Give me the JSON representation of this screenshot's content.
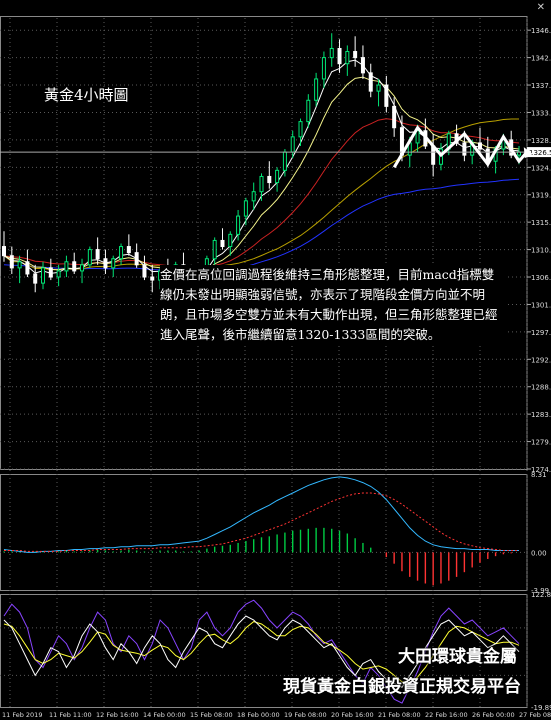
{
  "title_label": "黃金4小時圖",
  "commentary": "金價在高位回調過程後維持三角形態整理，目前macd指標雙線仍未發出明顯強弱信號，亦表示了現階段金價方向並不明朗，且市場多空雙方並未有大動作出現，但三角形態整理已經進入尾聲，後市繼續留意1320-1333區間的突破。",
  "watermark": {
    "line1": "大田環球貴金屬",
    "line2": "現貨黃金白銀投資正規交易平台"
  },
  "close_icon": "close-icon",
  "colors": {
    "background": "#000000",
    "grid": "#5a5a5a",
    "candle_up": "#00e676",
    "candle_down": "#ffffff",
    "ma_fast": "#ffffff",
    "ma_mid": "#f4f48c",
    "ma_slow": "#cc2222",
    "ma_blue": "#2233ff",
    "ma_gold": "#b8a000",
    "macd_signal": "#33b8ff",
    "macd_hist_pos": "#00cc44",
    "macd_hist_neg": "#ff3333",
    "macd_dotted": "#ff3333",
    "stoch_k": "#ffffff",
    "stoch_d": "#ffff33",
    "stoch_violet": "#8844ff",
    "triangle_arrow": "#ffffff",
    "price_marker_bg": "#ffffff"
  },
  "chart_data": [
    {
      "type": "candlestick",
      "title": "黃金4小時圖",
      "ylim": [
        1274.5,
        1348.5
      ],
      "yticks": [
        "1346.5",
        "1342.0",
        "1337.5",
        "1333.0",
        "1328.5",
        "1324.0",
        "1319.5",
        "1315.0",
        "1310.5",
        "1306.0",
        "1301.5",
        "1297.0",
        "1292.5",
        "1288.0",
        "1283.5",
        "1279.0",
        "1274.5"
      ],
      "current_price": "1326.5",
      "xticks": [
        "11 Feb 2019",
        "11 Feb 11:00",
        "12 Feb 16:00",
        "14 Feb 00:00",
        "15 Feb 08:00",
        "18 Feb 00:00",
        "19 Feb 08:00",
        "20 Feb 16:00",
        "21 Feb 08:00",
        "22 Feb 16:00",
        "26 Feb 00:00",
        "27 Feb 08:00"
      ],
      "candles": [
        [
          1311.0,
          1313.5,
          1308.5,
          1309.5
        ],
        [
          1309.5,
          1311.0,
          1306.5,
          1307.5
        ],
        [
          1307.5,
          1309.5,
          1305.0,
          1308.5
        ],
        [
          1308.5,
          1310.5,
          1306.0,
          1306.5
        ],
        [
          1306.5,
          1308.0,
          1303.5,
          1305.0
        ],
        [
          1305.0,
          1308.5,
          1304.0,
          1307.5
        ],
        [
          1307.5,
          1309.0,
          1305.5,
          1306.0
        ],
        [
          1306.0,
          1308.0,
          1304.5,
          1307.0
        ],
        [
          1307.0,
          1309.5,
          1306.0,
          1308.5
        ],
        [
          1308.5,
          1310.0,
          1306.5,
          1307.0
        ],
        [
          1307.0,
          1309.0,
          1305.0,
          1308.0
        ],
        [
          1308.0,
          1311.0,
          1307.5,
          1310.5
        ],
        [
          1310.5,
          1312.5,
          1308.0,
          1309.0
        ],
        [
          1309.0,
          1310.5,
          1306.5,
          1307.5
        ],
        [
          1307.5,
          1309.5,
          1306.0,
          1309.0
        ],
        [
          1309.0,
          1311.5,
          1308.0,
          1311.0
        ],
        [
          1311.0,
          1313.0,
          1309.5,
          1310.0
        ],
        [
          1310.0,
          1311.5,
          1307.5,
          1308.0
        ],
        [
          1308.0,
          1309.5,
          1305.5,
          1306.0
        ],
        [
          1306.0,
          1308.0,
          1303.5,
          1305.5
        ],
        [
          1305.5,
          1307.5,
          1304.0,
          1307.0
        ],
        [
          1307.0,
          1309.0,
          1305.5,
          1306.5
        ],
        [
          1306.5,
          1308.5,
          1305.0,
          1308.0
        ],
        [
          1308.0,
          1310.0,
          1306.5,
          1307.0
        ],
        [
          1307.0,
          1308.0,
          1302.0,
          1303.5
        ],
        [
          1303.5,
          1307.0,
          1302.5,
          1306.5
        ],
        [
          1306.5,
          1309.5,
          1305.5,
          1309.0
        ],
        [
          1309.0,
          1312.5,
          1308.0,
          1312.0
        ],
        [
          1312.0,
          1314.0,
          1310.5,
          1311.0
        ],
        [
          1311.0,
          1313.5,
          1309.5,
          1313.0
        ],
        [
          1313.0,
          1317.0,
          1312.0,
          1316.0
        ],
        [
          1316.0,
          1319.0,
          1314.5,
          1318.5
        ],
        [
          1318.5,
          1321.5,
          1317.0,
          1320.0
        ],
        [
          1320.0,
          1323.0,
          1318.5,
          1322.5
        ],
        [
          1322.5,
          1325.0,
          1320.5,
          1321.5
        ],
        [
          1321.5,
          1324.0,
          1320.0,
          1323.5
        ],
        [
          1323.5,
          1327.0,
          1322.5,
          1326.5
        ],
        [
          1326.5,
          1330.0,
          1325.5,
          1329.0
        ],
        [
          1329.0,
          1332.0,
          1327.5,
          1331.5
        ],
        [
          1331.5,
          1336.0,
          1330.5,
          1335.0
        ],
        [
          1335.0,
          1339.5,
          1334.0,
          1338.5
        ],
        [
          1338.5,
          1343.0,
          1337.0,
          1342.0
        ],
        [
          1342.0,
          1346.0,
          1340.5,
          1343.5
        ],
        [
          1343.5,
          1345.0,
          1339.5,
          1341.0
        ],
        [
          1341.0,
          1344.0,
          1339.0,
          1343.0
        ],
        [
          1343.0,
          1345.5,
          1340.5,
          1342.0
        ],
        [
          1342.0,
          1344.0,
          1338.5,
          1339.5
        ],
        [
          1339.5,
          1341.0,
          1335.5,
          1336.5
        ],
        [
          1336.5,
          1338.5,
          1334.0,
          1337.5
        ],
        [
          1337.5,
          1339.0,
          1333.0,
          1334.0
        ],
        [
          1334.0,
          1335.5,
          1329.0,
          1330.5
        ],
        [
          1330.5,
          1332.5,
          1325.0,
          1326.0
        ],
        [
          1326.0,
          1329.0,
          1324.0,
          1328.0
        ],
        [
          1328.0,
          1331.0,
          1326.5,
          1330.0
        ],
        [
          1330.0,
          1332.0,
          1327.0,
          1327.5
        ],
        [
          1327.5,
          1329.5,
          1322.5,
          1324.5
        ],
        [
          1324.5,
          1328.0,
          1323.5,
          1327.0
        ],
        [
          1327.0,
          1330.0,
          1326.0,
          1329.5
        ],
        [
          1329.5,
          1331.0,
          1327.5,
          1328.0
        ],
        [
          1328.0,
          1330.0,
          1325.0,
          1326.0
        ],
        [
          1326.0,
          1328.5,
          1324.5,
          1328.0
        ],
        [
          1328.0,
          1330.5,
          1326.5,
          1327.0
        ],
        [
          1327.0,
          1329.0,
          1324.0,
          1325.0
        ],
        [
          1325.0,
          1327.5,
          1323.0,
          1327.0
        ],
        [
          1327.0,
          1329.5,
          1326.0,
          1328.5
        ],
        [
          1328.5,
          1330.0,
          1325.5,
          1326.0
        ],
        [
          1326.0,
          1327.5,
          1324.5,
          1326.5
        ]
      ],
      "triangle_arrow_path": [
        [
          50,
          1324.0
        ],
        [
          53,
          1330.5
        ],
        [
          56,
          1326.0
        ],
        [
          59,
          1329.5
        ],
        [
          62,
          1324.5
        ],
        [
          64,
          1329.0
        ],
        [
          66,
          1325.0
        ],
        [
          67,
          1326.5
        ]
      ]
    },
    {
      "type": "macd",
      "ylim": [
        -3.99,
        8.31
      ],
      "yticks": [
        "8.31",
        "0.00",
        "-3.99"
      ],
      "hist": [
        0.1,
        0.1,
        0.1,
        0,
        0.1,
        0.1,
        0,
        0.1,
        0.2,
        0.1,
        0.1,
        0.2,
        0.3,
        0.2,
        0.1,
        0.2,
        0.3,
        0.2,
        0.1,
        0.1,
        0.2,
        0.2,
        0.2,
        0.1,
        0.1,
        0.2,
        0.4,
        0.6,
        0.7,
        0.8,
        1.0,
        1.2,
        1.4,
        1.6,
        1.7,
        1.9,
        2.1,
        2.3,
        2.4,
        2.5,
        2.6,
        2.6,
        2.5,
        2.3,
        2.0,
        1.5,
        1.0,
        0.5,
        0,
        -0.5,
        -1.2,
        -2.0,
        -2.6,
        -3.0,
        -3.3,
        -3.5,
        -3.3,
        -3.0,
        -2.6,
        -2.1,
        -1.6,
        -1.1,
        -0.7,
        -0.4,
        -0.2,
        -0.1,
        0.0
      ],
      "signal": [
        0.3,
        0.2,
        0.1,
        0,
        0,
        0.1,
        0.1,
        0.2,
        0.2,
        0.3,
        0.3,
        0.4,
        0.4,
        0.5,
        0.5,
        0.6,
        0.6,
        0.7,
        0.7,
        0.7,
        0.8,
        0.8,
        0.9,
        1.0,
        1.1,
        1.2,
        1.5,
        1.9,
        2.3,
        2.7,
        3.2,
        3.7,
        4.2,
        4.6,
        5.0,
        5.5,
        5.9,
        6.3,
        6.7,
        7.1,
        7.4,
        7.7,
        7.9,
        8.0,
        7.9,
        7.7,
        7.4,
        7.0,
        6.4,
        5.6,
        4.6,
        3.6,
        2.6,
        1.8,
        1.2,
        0.8,
        0.6,
        0.5,
        0.4,
        0.4,
        0.3,
        0.3,
        0.3,
        0.2,
        0.2,
        0.2,
        0.2
      ],
      "signal_dotted": [
        0.2,
        0.2,
        0.2,
        0.1,
        0.1,
        0.1,
        0.1,
        0.1,
        0.2,
        0.2,
        0.2,
        0.2,
        0.3,
        0.3,
        0.3,
        0.3,
        0.4,
        0.4,
        0.4,
        0.4,
        0.5,
        0.5,
        0.5,
        0.5,
        0.6,
        0.6,
        0.7,
        0.8,
        0.9,
        1.1,
        1.3,
        1.5,
        1.8,
        2.1,
        2.4,
        2.7,
        3.0,
        3.4,
        3.8,
        4.2,
        4.6,
        5.0,
        5.4,
        5.7,
        6.0,
        6.2,
        6.3,
        6.3,
        6.2,
        6.0,
        5.6,
        5.1,
        4.5,
        3.9,
        3.3,
        2.7,
        2.1,
        1.6,
        1.2,
        0.9,
        0.7,
        0.5,
        0.4,
        0.3,
        0.2,
        0.2,
        0.2
      ]
    },
    {
      "type": "stochastic",
      "ylim": [
        -19.89,
        122.83
      ],
      "yticks": [
        "122.83",
        "-19.89"
      ],
      "k": [
        90,
        80,
        60,
        40,
        20,
        35,
        55,
        50,
        30,
        45,
        70,
        85,
        75,
        55,
        40,
        60,
        50,
        35,
        55,
        70,
        60,
        40,
        30,
        50,
        65,
        80,
        75,
        60,
        55,
        70,
        85,
        95,
        90,
        80,
        70,
        65,
        80,
        90,
        85,
        75,
        65,
        55,
        60,
        45,
        30,
        20,
        35,
        40,
        25,
        15,
        10,
        5,
        20,
        35,
        55,
        70,
        85,
        90,
        80,
        70,
        75,
        65,
        55,
        60,
        70,
        60,
        50
      ],
      "d": [
        85,
        82,
        70,
        55,
        40,
        35,
        40,
        48,
        45,
        42,
        50,
        62,
        75,
        72,
        58,
        52,
        50,
        48,
        45,
        52,
        58,
        55,
        45,
        40,
        48,
        60,
        70,
        72,
        65,
        60,
        68,
        80,
        88,
        85,
        78,
        70,
        70,
        78,
        82,
        80,
        72,
        62,
        58,
        52,
        45,
        35,
        28,
        30,
        32,
        28,
        20,
        12,
        10,
        18,
        30,
        45,
        60,
        75,
        82,
        80,
        75,
        70,
        65,
        60,
        62,
        62,
        58
      ],
      "violet": [
        95,
        110,
        100,
        80,
        40,
        30,
        50,
        70,
        60,
        40,
        55,
        80,
        100,
        90,
        60,
        50,
        70,
        60,
        40,
        60,
        90,
        80,
        60,
        40,
        55,
        90,
        100,
        80,
        70,
        80,
        100,
        110,
        115,
        105,
        90,
        80,
        90,
        100,
        95,
        85,
        70,
        60,
        65,
        50,
        35,
        20,
        10,
        30,
        20,
        5,
        -10,
        -15,
        5,
        25,
        50,
        75,
        95,
        105,
        95,
        85,
        90,
        80,
        70,
        75,
        80,
        70,
        60
      ]
    }
  ]
}
